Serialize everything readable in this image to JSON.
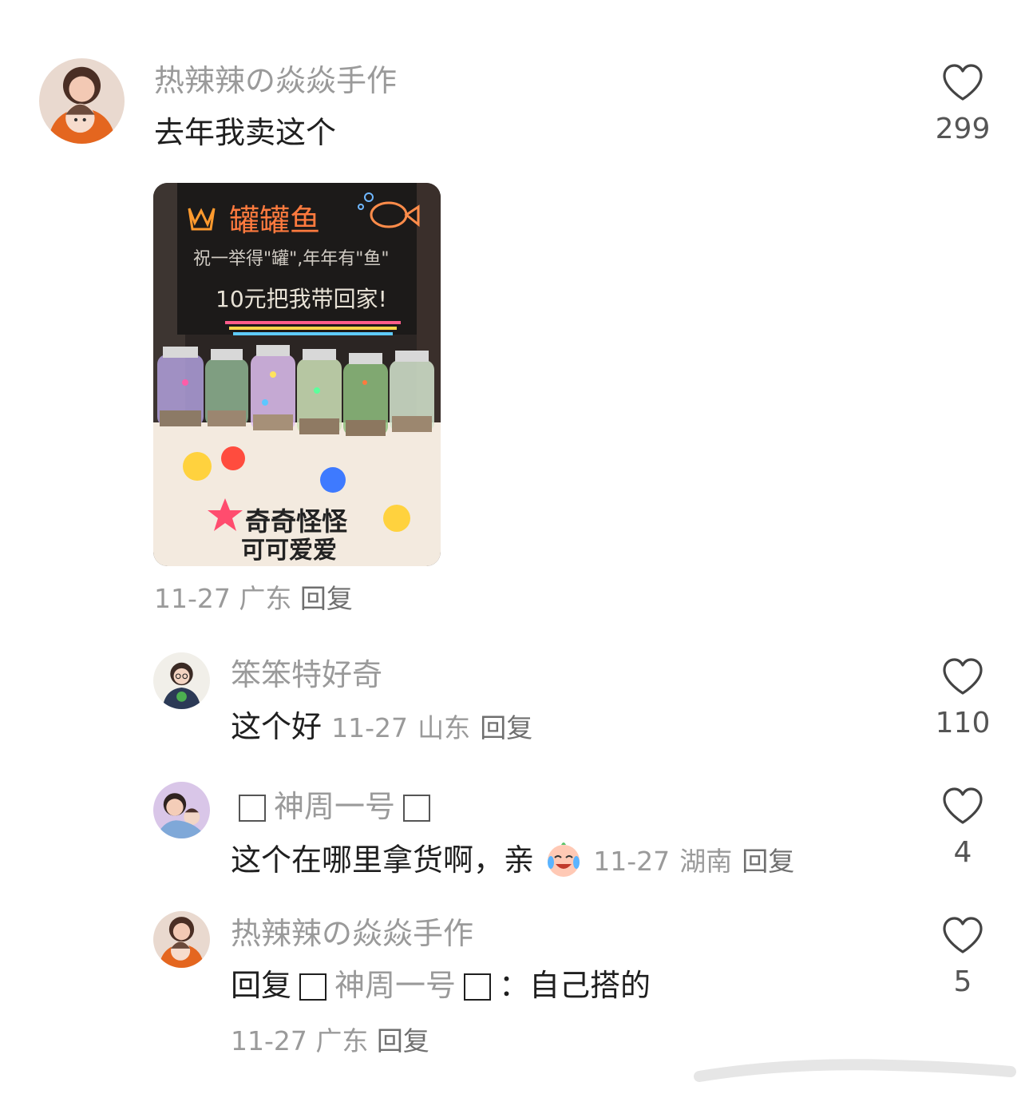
{
  "comments": [
    {
      "username": "热辣辣の焱焱手作",
      "text": "去年我卖这个",
      "date": "11-27",
      "location": "广东",
      "reply_label": "回复",
      "likes": "299",
      "photo_text": {
        "title": "罐罐鱼",
        "line1": "祝一举得\"罐\",年年有\"鱼\"",
        "line2": "10元把我带回家!",
        "cloth1": "奇奇怪怪",
        "cloth2": "可可爱爱"
      }
    },
    {
      "username": "笨笨特好奇",
      "text": "这个好",
      "date": "11-27",
      "location": "山东",
      "reply_label": "回复",
      "likes": "110"
    },
    {
      "username": "神周一号",
      "text": "这个在哪里拿货啊，亲",
      "emoji": "crying-laughing-emoji",
      "date": "11-27",
      "location": "湖南",
      "reply_label": "回复",
      "likes": "4"
    },
    {
      "username": "热辣辣の焱焱手作",
      "reply_prefix": "回复",
      "reply_to": "神周一号",
      "text": "：自己搭的",
      "date": "11-27",
      "location": "广东",
      "reply_label": "回复",
      "likes": "5"
    }
  ],
  "icons": {
    "like": "heart-outline-icon"
  },
  "colors": {
    "username": "#9a9a9a",
    "text": "#1f1f1f",
    "meta": "#9a9a9a"
  }
}
